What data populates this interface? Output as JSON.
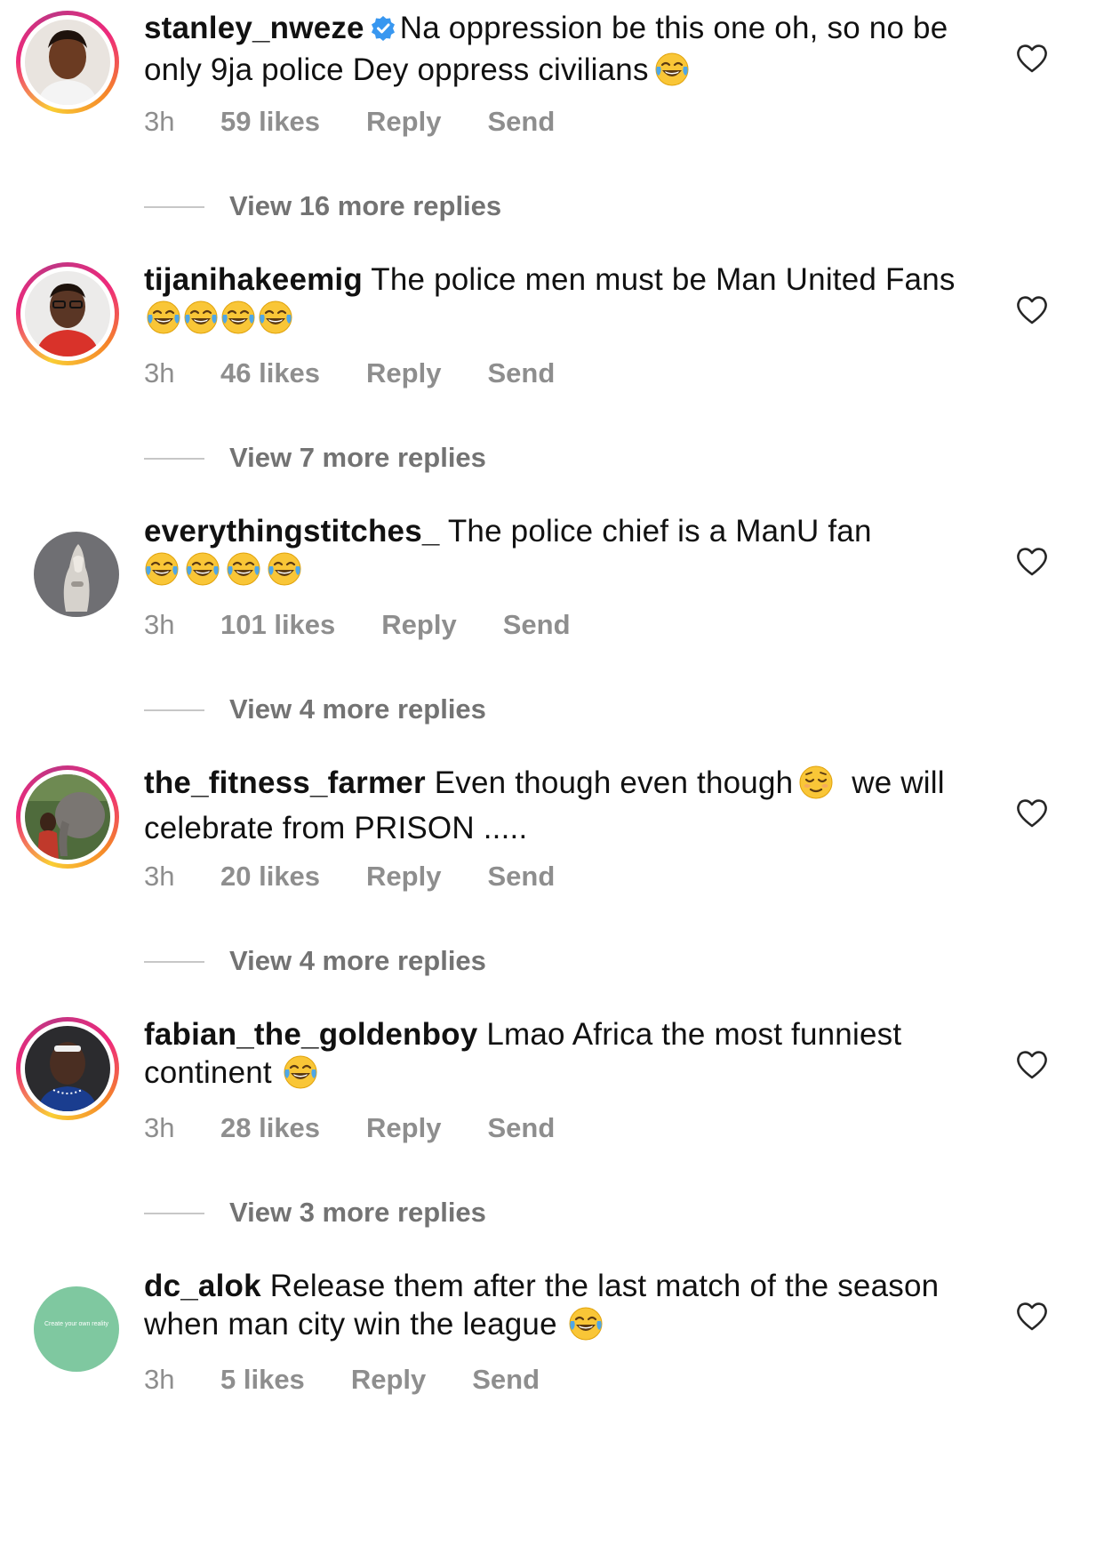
{
  "comments": [
    {
      "username": "stanley_nweze",
      "verified": true,
      "text": "Na oppression be this one oh, so no be only 9ja police Dey oppress civilians",
      "emoji": "😂",
      "time": "3h",
      "likes": "59 likes",
      "reply": "Reply",
      "send": "Send",
      "view_replies": "View 16 more replies",
      "story_ring": true
    },
    {
      "username": "tijanihakeemig",
      "verified": false,
      "text": "The police men must be Man United Fans",
      "emoji": "😂😂😂😂",
      "time": "3h",
      "likes": "46 likes",
      "reply": "Reply",
      "send": "Send",
      "view_replies": "View 7 more replies",
      "story_ring": true
    },
    {
      "username": "everythingstitches_",
      "verified": false,
      "text": "The police chief is a ManU fan",
      "emoji": "😂😂😂😂",
      "time": "3h",
      "likes": "101 likes",
      "reply": "Reply",
      "send": "Send",
      "view_replies": "View 4 more replies",
      "story_ring": false
    },
    {
      "username": "the_fitness_farmer",
      "verified": false,
      "text": "Even though even though",
      "emoji": "😌",
      "text_after": "we will celebrate from PRISON .....",
      "time": "3h",
      "likes": "20 likes",
      "reply": "Reply",
      "send": "Send",
      "view_replies": "View 4 more replies",
      "story_ring": true
    },
    {
      "username": "fabian_the_goldenboy",
      "verified": false,
      "text": "Lmao Africa the most funniest continent",
      "emoji": "😂",
      "time": "3h",
      "likes": "28 likes",
      "reply": "Reply",
      "send": "Send",
      "view_replies": "View 3 more replies",
      "story_ring": true
    },
    {
      "username": "dc_alok",
      "verified": false,
      "text": "Release them after the last match of the season when man city win the league",
      "emoji": "😂",
      "time": "3h",
      "likes": "5 likes",
      "reply": "Reply",
      "send": "Send",
      "story_ring": false,
      "avatar_text": "Create your own reality"
    }
  ],
  "icons": {
    "like": "heart-outline-icon",
    "verified": "verified-badge-icon",
    "emoji_laugh": "face-with-tears-of-joy-emoji",
    "emoji_relieved": "relieved-face-emoji"
  },
  "colors": {
    "secondary_text": "#8e8e8e",
    "verified_blue": "#3897f0",
    "story_ring_start": "#f9ce34",
    "story_ring_mid": "#ee2a7b",
    "story_ring_end": "#6228d7"
  }
}
